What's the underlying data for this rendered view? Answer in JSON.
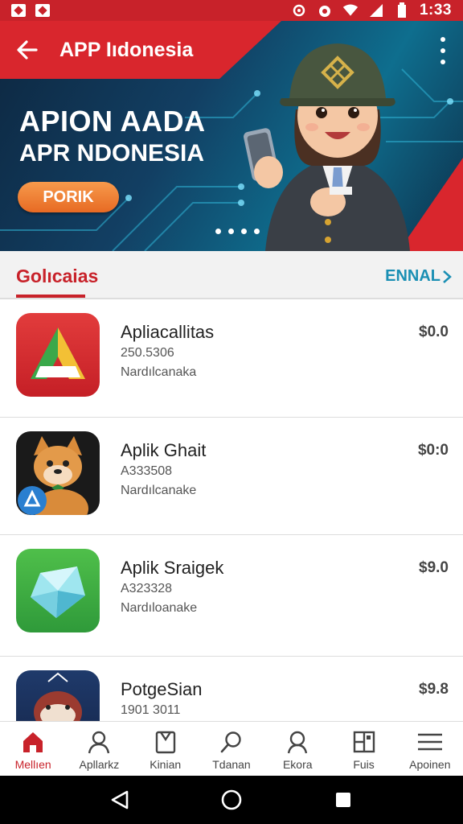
{
  "status_bar": {
    "time": "1:33"
  },
  "header": {
    "title": "APP Iıdonesia"
  },
  "banner": {
    "headline": "APION AADA",
    "subhead": "APR NDONESIA",
    "cta_label": "PORIK"
  },
  "section": {
    "title": "Golıcaias",
    "see_all": "ENNAL"
  },
  "apps": [
    {
      "name": "Apliacallitas",
      "meta": "250.5306",
      "developer": "Nardılcanaka",
      "price": "$0.0"
    },
    {
      "name": "Aplik Ghait",
      "meta": "A333508",
      "developer": "Nardılcanake",
      "price": "$0:0"
    },
    {
      "name": "Aplik Sraigek",
      "meta": "A323328",
      "developer": "Nardıloanake",
      "price": "$9.0"
    },
    {
      "name": "PotgeSian",
      "meta": "1901 3011",
      "developer": "",
      "price": "$9.8"
    }
  ],
  "bottom_nav": [
    {
      "label": "Mellıen",
      "icon": "home-icon",
      "active": true
    },
    {
      "label": "Apllarkz",
      "icon": "person-icon"
    },
    {
      "label": "Kinian",
      "icon": "bookmark-icon"
    },
    {
      "label": "Tdanan",
      "icon": "search-icon"
    },
    {
      "label": "Ekora",
      "icon": "profile-icon"
    },
    {
      "label": "Fuis",
      "icon": "grid-icon"
    },
    {
      "label": "Apoinen",
      "icon": "menu-icon"
    }
  ],
  "colors": {
    "brand_red": "#c8222a",
    "link_blue": "#1a8fb4",
    "cta_orange": "#e76a23"
  }
}
